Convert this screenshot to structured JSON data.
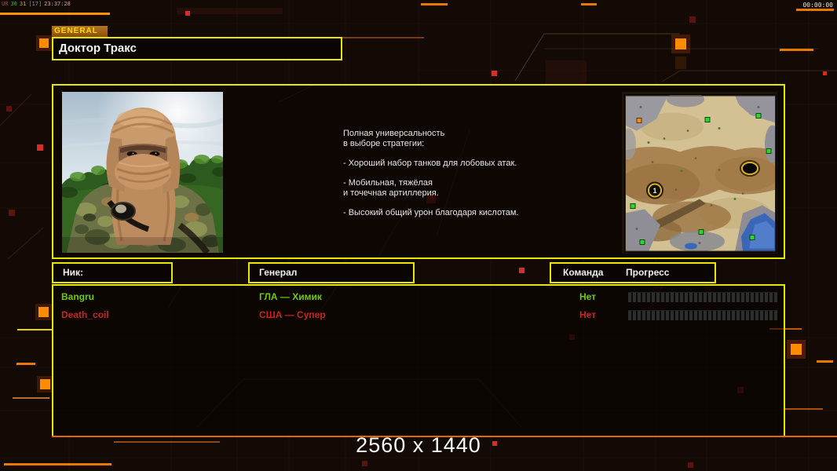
{
  "hud": {
    "debug_parts": [
      "UR",
      "30",
      "31",
      "[17]",
      "23:37:28"
    ],
    "timer": "00:00:00",
    "resolution_label": "2560 x 1440"
  },
  "panel": {
    "tab_label": "GENERAL",
    "general_name": "Доктор Тракс",
    "description_lines": [
      "Полная универсальность",
      "в выборе стратегии:",
      "- Хороший набор танков для лобовых атак.",
      "- Мобильная, тяжёлая",
      "и точечная артиллерия.",
      "- Высокий общий урон благодаря кислотам."
    ],
    "map": {
      "start_marker_label": "1"
    }
  },
  "players": {
    "headers": {
      "nick": "Ник:",
      "general": "Генерал",
      "team": "Команда",
      "progress": "Прогресс"
    },
    "rows": [
      {
        "nick": "Bangru",
        "general": "ГЛА — Химик",
        "team": "Нет",
        "progress_percent": 0,
        "status_color": "#6ecb00"
      },
      {
        "nick": "Death_coil",
        "general": "США — Супер",
        "team": "Нет",
        "progress_percent": 0,
        "status_color": "#cc2418"
      }
    ]
  },
  "colors": {
    "frame_yellow": "#e9e600",
    "accent_orange": "#e87800",
    "ready_green": "#6ecb00",
    "not_ready_red": "#cc2418"
  }
}
